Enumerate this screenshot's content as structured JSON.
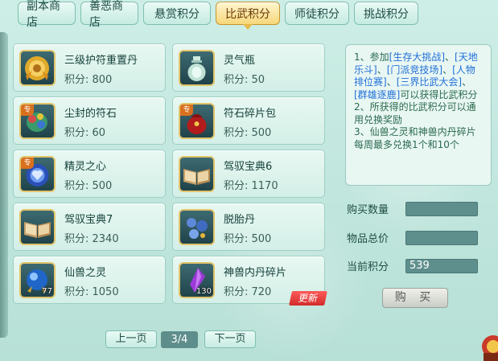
{
  "tabs": [
    {
      "label": "副本商店",
      "active": false
    },
    {
      "label": "善恶商店",
      "active": false
    },
    {
      "label": "悬赏积分",
      "active": false
    },
    {
      "label": "比武积分",
      "active": true
    },
    {
      "label": "师徒积分",
      "active": false
    },
    {
      "label": "挑战积分",
      "active": false
    }
  ],
  "items": [
    {
      "name": "三级护符重置丹",
      "price": "积分: 800",
      "icon": "gold-talisman-pill-icon",
      "special": false,
      "count": ""
    },
    {
      "name": "灵气瓶",
      "price": "积分: 50",
      "icon": "spirit-vase-icon",
      "special": false,
      "count": ""
    },
    {
      "name": "尘封的符石",
      "price": "积分: 60",
      "icon": "rune-stone-icon",
      "special": true,
      "count": ""
    },
    {
      "name": "符石碎片包",
      "price": "积分: 500",
      "icon": "red-pouch-icon",
      "special": true,
      "count": ""
    },
    {
      "name": "精灵之心",
      "price": "积分: 500",
      "icon": "spirit-heart-icon",
      "special": true,
      "count": ""
    },
    {
      "name": "驾驭宝典6",
      "price": "积分: 1170",
      "icon": "open-book-icon",
      "special": false,
      "count": ""
    },
    {
      "name": "驾驭宝典7",
      "price": "积分: 2340",
      "icon": "open-book-icon",
      "special": false,
      "count": ""
    },
    {
      "name": "脱胎丹",
      "price": "积分: 500",
      "icon": "blue-pills-icon",
      "special": false,
      "count": ""
    },
    {
      "name": "仙兽之灵",
      "price": "积分: 1050",
      "icon": "blue-orb-icon",
      "special": false,
      "count": "77"
    },
    {
      "name": "神兽内丹碎片",
      "price": "积分: 720",
      "icon": "purple-crystal-icon",
      "special": false,
      "count": "130",
      "new_tag": "更新"
    }
  ],
  "special_badge": "专",
  "info": {
    "line1_prefix": "1、参加",
    "hl1": "[生存大挑战]",
    "sep1": "、",
    "hl2": "[天地乐斗]",
    "sep2": "、",
    "hl3": "[门派竞技场]",
    "sep3": "、",
    "hl4": "[人物排位赛]",
    "sep4": "、",
    "hl5": "[三界比武大会]",
    "sep5": "、",
    "hl6": "[群雄逐鹿]",
    "line1_suffix": "可以获得比武积分",
    "line2": "2、所获得的比武积分可以通用兑换奖励",
    "line3": "3、仙兽之灵和神兽内丹碎片每周最多兑换1个和10个"
  },
  "form": {
    "qty_label": "购买数量",
    "qty_value": "",
    "total_label": "物品总价",
    "total_value": "",
    "current_label": "当前积分",
    "current_value": "539",
    "buy_label": "购 买"
  },
  "pager": {
    "prev": "上一页",
    "indicator": "3/4",
    "next": "下一页"
  }
}
